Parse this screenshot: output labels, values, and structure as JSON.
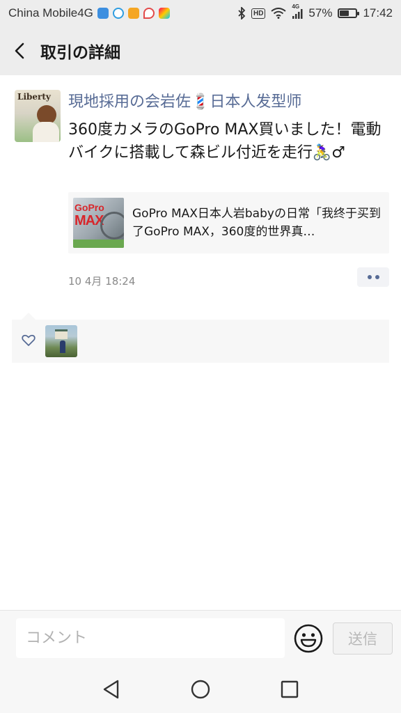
{
  "status_bar": {
    "carrier": "China Mobile4G",
    "network_badge": "HD",
    "signal_label": "4G",
    "battery_percent": "57%",
    "battery_level": 0.57,
    "time": "17:42"
  },
  "header": {
    "title": "取引の詳細"
  },
  "post": {
    "author": "現地採用の会岩佐💈日本人发型师",
    "text": "360度カメラのGoPro MAX買いました！電動バイクに搭載して森ビル付近を走行🚴‍♀️♂",
    "link": {
      "thumbnail_line1": "GoPro",
      "thumbnail_line2": "MAX",
      "title": "GoPro MAX日本人岩babyの日常「我终于买到了GoPro MAX，360度的世界真…"
    },
    "time": "10 4月 18:24"
  },
  "avatar": {
    "brand_text": "Liberty"
  },
  "comment_bar": {
    "placeholder": "コメント",
    "send_label": "送信"
  },
  "colors": {
    "name_blue": "#576b95",
    "background": "#ededed"
  }
}
